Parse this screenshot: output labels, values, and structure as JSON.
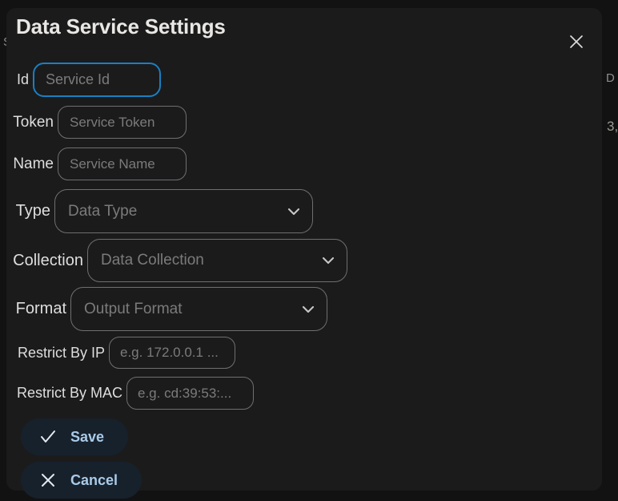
{
  "background": {
    "fragments": [
      {
        "name": "left-fragment",
        "text": "S"
      },
      {
        "name": "right-fragment-top",
        "text": "D"
      },
      {
        "name": "right-fragment-bottom",
        "text": "3,"
      }
    ]
  },
  "dialog": {
    "title": "Data Service Settings",
    "close_icon": "close-icon",
    "fields": [
      {
        "key": "id",
        "label": "Id",
        "placeholder": "Service Id",
        "value": "",
        "type": "text",
        "focused": true
      },
      {
        "key": "token",
        "label": "Token",
        "placeholder": "Service Token",
        "value": "",
        "type": "text",
        "focused": false
      },
      {
        "key": "name",
        "label": "Name",
        "placeholder": "Service Name",
        "value": "",
        "type": "text",
        "focused": false
      },
      {
        "key": "type",
        "label": "Type",
        "placeholder": "Data Type",
        "value": "",
        "type": "select",
        "focused": false
      },
      {
        "key": "collection",
        "label": "Collection",
        "placeholder": "Data Collection",
        "value": "",
        "type": "select",
        "focused": false
      },
      {
        "key": "format",
        "label": "Format",
        "placeholder": "Output Format",
        "value": "",
        "type": "select",
        "focused": false
      },
      {
        "key": "ip",
        "label": "Restrict By IP",
        "placeholder": "e.g. 172.0.0.1 ...",
        "value": "",
        "type": "text",
        "focused": false
      },
      {
        "key": "mac",
        "label": "Restrict By MAC",
        "placeholder": "e.g. cd:39:53:...",
        "value": "",
        "type": "text",
        "focused": false
      }
    ],
    "actions": {
      "save": {
        "label": "Save",
        "icon": "check-icon"
      },
      "cancel": {
        "label": "Cancel",
        "icon": "x-icon"
      }
    },
    "select_icon": "chevron-down-icon"
  },
  "colors": {
    "dialog_background": "#1b1b1c",
    "page_background": "#121213",
    "focus_border": "#1a7fc1",
    "field_border": "#6f6f6f",
    "placeholder_text": "#7b7b7b",
    "label_text": "#dedede",
    "title_text": "#e9e7e4",
    "button_background": "#17212c",
    "button_text": "#a9cbe8"
  }
}
